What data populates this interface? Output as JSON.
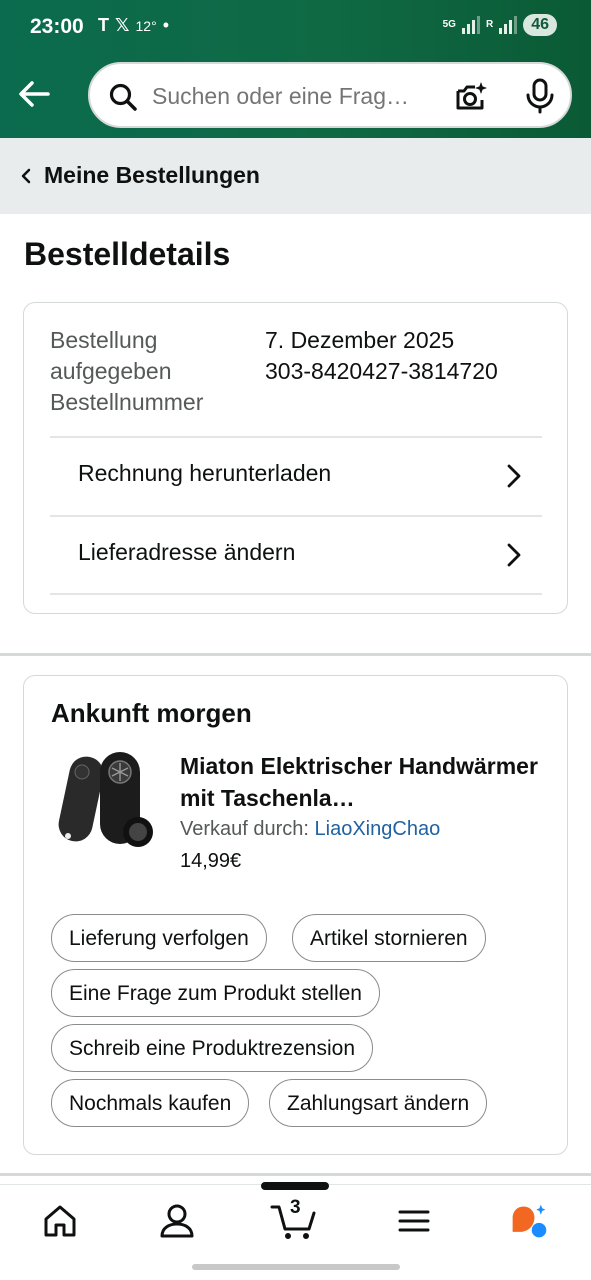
{
  "status_bar": {
    "time": "23:00",
    "temperature": "12°",
    "network": "5G",
    "roaming": "R",
    "battery": "46"
  },
  "search": {
    "placeholder": "Suchen oder eine Frag…"
  },
  "breadcrumb": {
    "label": "Meine Bestellungen"
  },
  "page_title": "Bestelldetails",
  "order": {
    "placed_label": "Bestellung aufgegeben",
    "placed_value": "7. Dezember 2025",
    "number_label": "Bestellnummer",
    "number_value": "303-8420427-3814720",
    "actions": [
      {
        "label": "Rechnung herunterladen"
      },
      {
        "label": "Lieferadresse ändern"
      }
    ]
  },
  "arrival": {
    "title": "Ankunft morgen",
    "product": {
      "name": "Miaton Elektrischer Handwärmer mit Taschenla…",
      "seller_prefix": "Verkauf durch:",
      "seller_name": "LiaoXingChao",
      "price": "14,99€"
    },
    "buttons": [
      {
        "label": "Lieferung verfolgen"
      },
      {
        "label": "Artikel stornieren"
      },
      {
        "label": "Eine Frage zum Produkt stellen"
      },
      {
        "label": "Schreib eine Produktrezension"
      },
      {
        "label": "Nochmals kaufen"
      },
      {
        "label": "Zahlungsart ändern"
      }
    ]
  },
  "bottom_nav": {
    "cart_count": "3",
    "items": [
      "home-icon",
      "account-icon",
      "cart-icon",
      "menu-icon",
      "rufus-icon"
    ],
    "accent_color": "#f26722",
    "assistant_color": "#1a8cff"
  },
  "colors": {
    "header": "#0b6b4e",
    "link": "#2162a1"
  }
}
